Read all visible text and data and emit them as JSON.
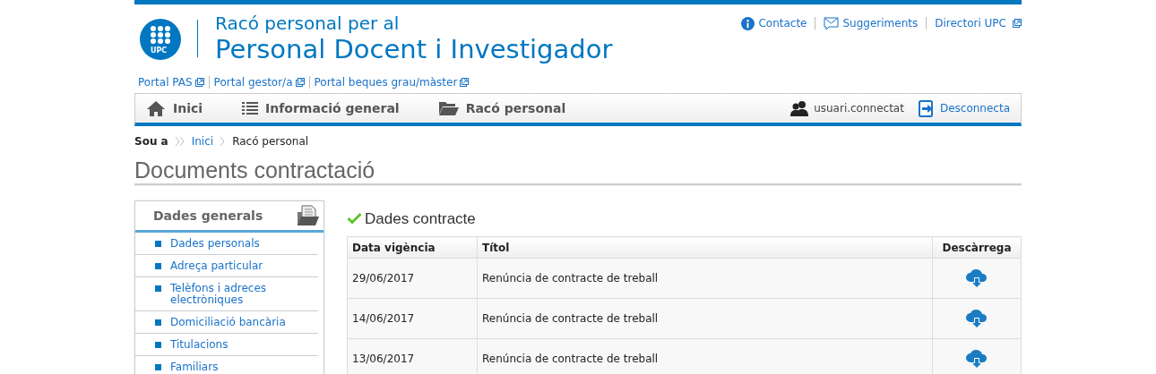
{
  "logo": {
    "text": "UPC"
  },
  "header": {
    "subtitle": "Racó personal per al",
    "title": "Personal Docent i Investigador"
  },
  "top_links": [
    {
      "label": "Contacte",
      "kind": "info"
    },
    {
      "label": "Suggeriments",
      "kind": "mail"
    },
    {
      "label": "Directori UPC",
      "kind": "external"
    }
  ],
  "portal_links": [
    "Portal PAS",
    "Portal gestor/a",
    "Portal beques grau/màster"
  ],
  "nav": {
    "items": [
      {
        "label": "Inici",
        "kind": "home"
      },
      {
        "label": "Informació general",
        "kind": "list"
      },
      {
        "label": "Racó personal",
        "kind": "folder"
      }
    ],
    "user": "usuari.connectat",
    "logout": "Desconnecta"
  },
  "breadcrumb": {
    "label": "Sou a",
    "items": [
      "Inici",
      "Racó personal"
    ]
  },
  "page_title": "Documents contractació",
  "sidebar": {
    "title": "Dades generals",
    "items": [
      "Dades personals",
      "Adreça particular",
      "Telèfons i adreces electròniques",
      "Domiciliació bancària",
      "Titulacions",
      "Familiars"
    ]
  },
  "section": {
    "title": "Dades contracte"
  },
  "table": {
    "columns": [
      "Data vigència",
      "Títol",
      "Descàrrega"
    ],
    "rows": [
      {
        "date": "29/06/2017",
        "title": "Renúncia de contracte de treball"
      },
      {
        "date": "14/06/2017",
        "title": "Renúncia de contracte de treball"
      },
      {
        "date": "13/06/2017",
        "title": "Renúncia de contracte de treball"
      }
    ]
  }
}
